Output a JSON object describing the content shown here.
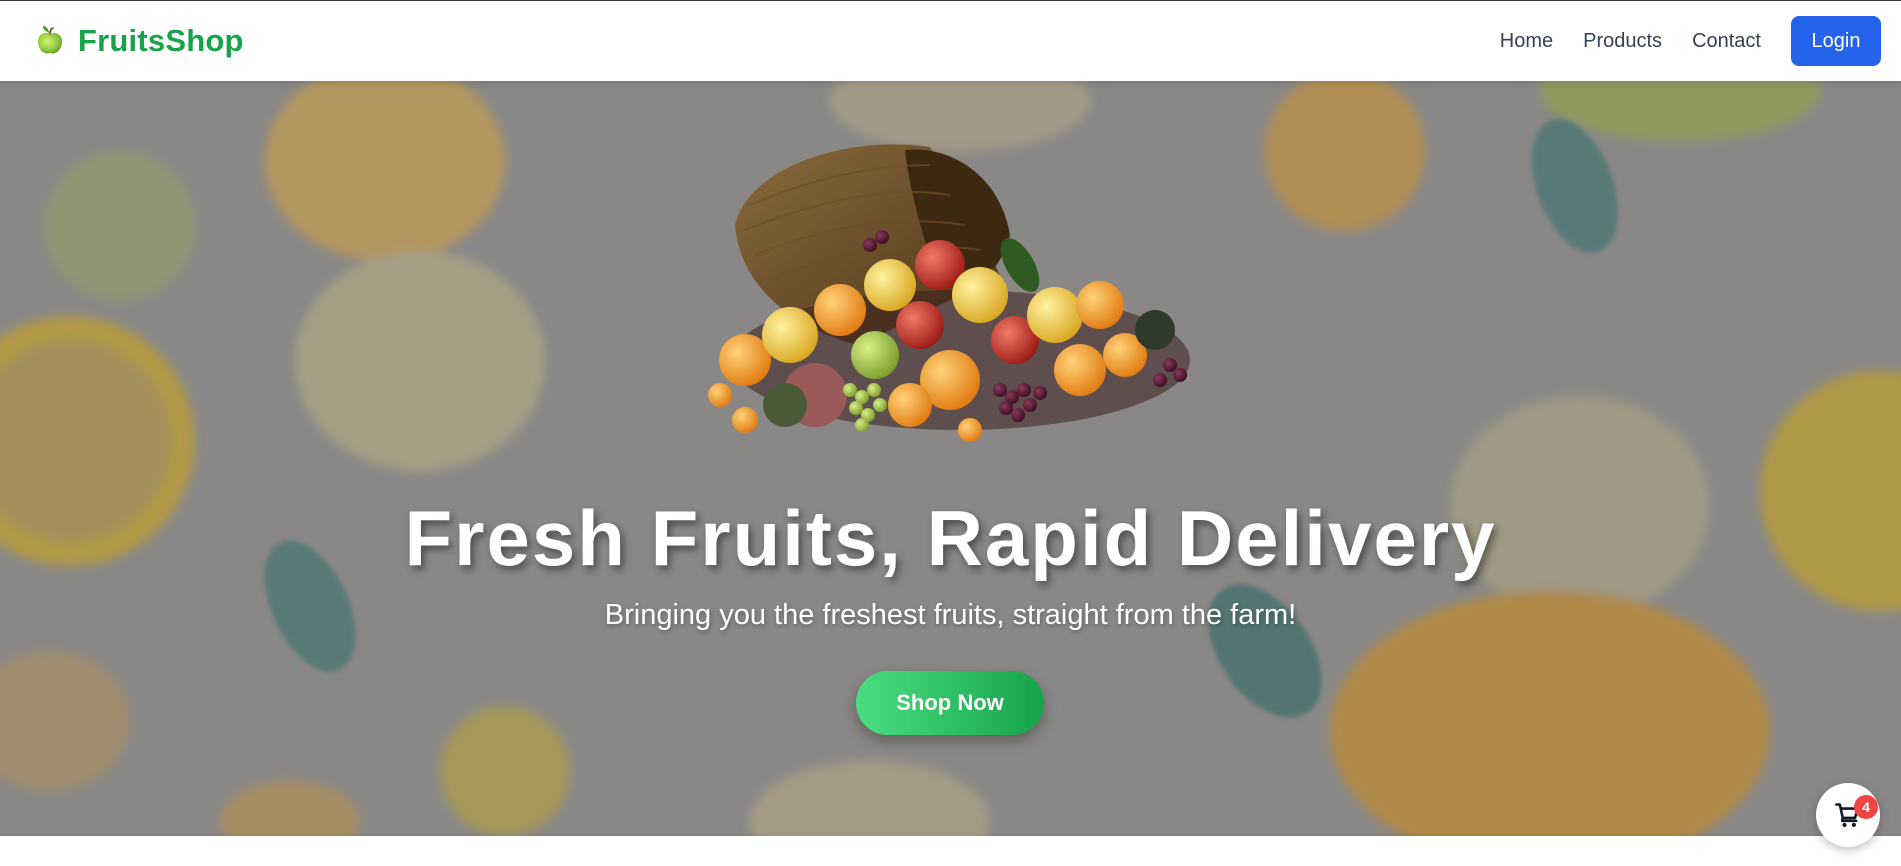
{
  "navbar": {
    "brand_name": "FruitsShop",
    "brand_icon": "apple-icon",
    "links": [
      "Home",
      "Products",
      "Contact"
    ],
    "login_label": "Login"
  },
  "hero": {
    "image": "fruit-basket-cornucopia",
    "title": "Fresh Fruits, Rapid Delivery",
    "subtitle": "Bringing you the freshest fruits, straight from the farm!",
    "cta_label": "Shop Now"
  },
  "cart": {
    "icon": "cart-icon",
    "count": "4"
  },
  "colors": {
    "brand": "#16a34a",
    "login_button": "#2563eb",
    "cta_start": "#4ade80",
    "cta_end": "#16a34a",
    "badge": "#ef4444",
    "nav_text": "#374151"
  }
}
